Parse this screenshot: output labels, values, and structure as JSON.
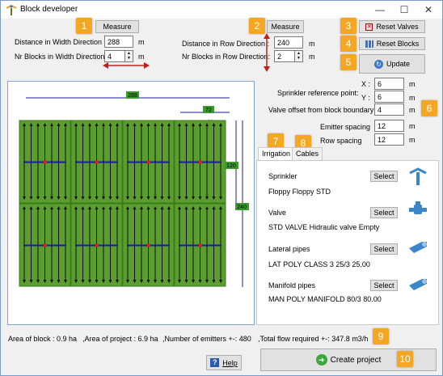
{
  "window": {
    "title": "Block developer",
    "minimize": "—",
    "maximize": "☐",
    "close": "✕"
  },
  "badges": [
    "1",
    "2",
    "3",
    "4",
    "5",
    "6",
    "7",
    "8",
    "9",
    "10"
  ],
  "width_section": {
    "measure_label": "Measure",
    "distance_label": "Distance in Width Direction :",
    "distance_value": "288",
    "distance_unit": "m",
    "blocks_label": "Nr Blocks in Width Direction:",
    "blocks_value": "4",
    "blocks_unit": "m"
  },
  "row_section": {
    "measure_label": "Measure",
    "distance_label": "Distance in Row Direction :",
    "distance_value": "240",
    "distance_unit": "m",
    "blocks_label": "Nr Blocks in Row Direction:",
    "blocks_value": "2",
    "blocks_unit": "m"
  },
  "buttons": {
    "reset_valves": "Reset Valves",
    "reset_blocks": "Reset Blocks",
    "update": "Update",
    "help": "Help",
    "create_project": "Create project"
  },
  "params": {
    "sprinkler_ref_label": "Sprinkler reference point:",
    "x_label": "X :",
    "x_value": "6",
    "y_label": "Y :",
    "y_value": "6",
    "valve_offset_label": "Valve offset from block boundary",
    "valve_offset_value": "4",
    "emitter_spacing_label": "Emitter spacing",
    "emitter_spacing_value": "12",
    "row_spacing_label": "Row spacing",
    "row_spacing_value": "12",
    "unit": "m"
  },
  "tabs": {
    "irrigation": "Irrigation",
    "cables": "Cables"
  },
  "irrigation": {
    "sprinkler_label": "Sprinkler",
    "sprinkler_value": "Floppy Floppy STD",
    "valve_label": "Valve",
    "valve_value": "STD VALVE Hidraulic valve Empty",
    "lateral_label": "Lateral pipes",
    "lateral_value": "LAT POLY CLASS 3 25/3    25.00",
    "manifold_label": "Manifold pipes",
    "manifold_value": "MAN POLY MANIFOLD 80/3    80.00",
    "select_label": "Select"
  },
  "diagram": {
    "width_total": "288",
    "block_width": "72",
    "block_height": "120",
    "height_total": "240",
    "axis_y": "Y",
    "axis_x": "X"
  },
  "status": {
    "block_area": "Area of block : 0.9 ha",
    "project_area": ",Area of project : 6.9 ha",
    "emitters": ",Number of emitters +-: 480",
    "flow": ",Total flow required +-: 347.8 m3/h"
  },
  "colors": {
    "field": "#5a9e2f",
    "badge": "#f5a623",
    "line": "#1a1aa0",
    "valve": "#e02020"
  }
}
